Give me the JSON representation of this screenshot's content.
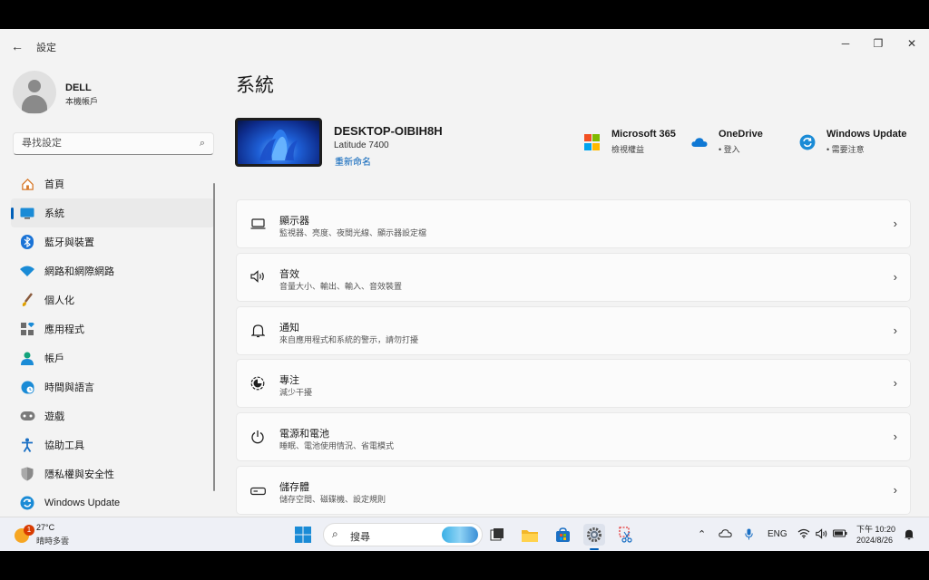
{
  "window": {
    "title": "設定",
    "back": "←",
    "minimize": "─",
    "restore": "❐",
    "close": "✕"
  },
  "profile": {
    "name": "DELL",
    "account_type": "本機帳戶"
  },
  "search": {
    "placeholder": "尋找設定"
  },
  "sidebar": {
    "items": [
      {
        "label": "首頁",
        "icon": "home-icon"
      },
      {
        "label": "系統",
        "icon": "system-icon",
        "active": true
      },
      {
        "label": "藍牙與裝置",
        "icon": "bluetooth-icon"
      },
      {
        "label": "網路和網際網路",
        "icon": "wifi-icon"
      },
      {
        "label": "個人化",
        "icon": "brush-icon"
      },
      {
        "label": "應用程式",
        "icon": "apps-icon"
      },
      {
        "label": "帳戶",
        "icon": "account-icon"
      },
      {
        "label": "時間與語言",
        "icon": "globe-clock-icon"
      },
      {
        "label": "遊戲",
        "icon": "gamepad-icon"
      },
      {
        "label": "協助工具",
        "icon": "accessibility-icon"
      },
      {
        "label": "隱私權與安全性",
        "icon": "shield-icon"
      },
      {
        "label": "Windows Update",
        "icon": "update-icon"
      }
    ]
  },
  "main": {
    "title": "系統",
    "device": {
      "name": "DESKTOP-OIBIH8H",
      "model": "Latitude 7400",
      "rename": "重新命名"
    },
    "services": [
      {
        "name": "Microsoft 365",
        "sub": "檢視權益",
        "icon": "microsoft-logo-icon"
      },
      {
        "name": "OneDrive",
        "sub": "• 登入",
        "icon": "onedrive-cloud-icon"
      },
      {
        "name": "Windows Update",
        "sub": "• 需要注意",
        "icon": "update-icon"
      }
    ],
    "cards": [
      {
        "title": "顯示器",
        "sub": "監視器、亮度、夜間光線、顯示器設定檔",
        "icon": "display-icon"
      },
      {
        "title": "音效",
        "sub": "音量大小、輸出、輸入、音效裝置",
        "icon": "speaker-icon"
      },
      {
        "title": "通知",
        "sub": "來自應用程式和系統的警示，請勿打擾",
        "icon": "bell-icon"
      },
      {
        "title": "專注",
        "sub": "減少干擾",
        "icon": "focus-icon"
      },
      {
        "title": "電源和電池",
        "sub": "睡眠、電池使用情況、省電模式",
        "icon": "power-icon"
      },
      {
        "title": "儲存體",
        "sub": "儲存空間、磁碟機、設定規則",
        "icon": "storage-icon"
      }
    ]
  },
  "taskbar": {
    "weather_temp": "27°C",
    "weather_desc": "晴時多雲",
    "weather_badge": "1",
    "search_label": "搜尋",
    "language": "ENG",
    "time": "下午 10:20",
    "date": "2024/8/26"
  },
  "colors": {
    "accent": "#005fb8",
    "background": "#f3f3f3",
    "card": "#fbfbfb"
  }
}
